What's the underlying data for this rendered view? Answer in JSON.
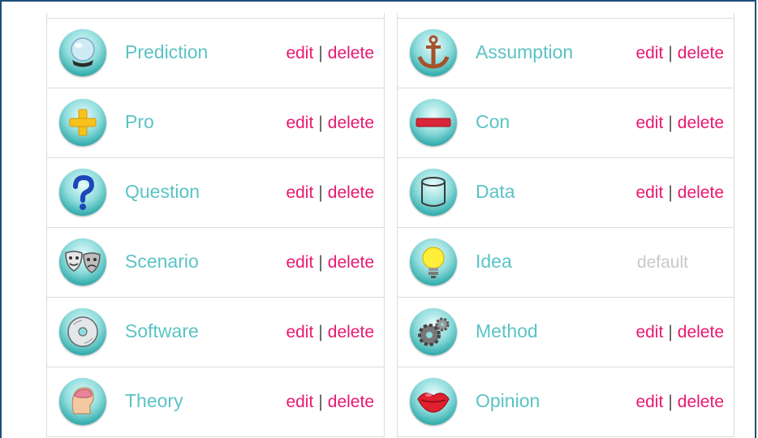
{
  "left_column": [
    {
      "label": "Prediction",
      "icon": "crystal-ball-icon",
      "edit": "edit",
      "sep": "|",
      "delete": "delete"
    },
    {
      "label": "Pro",
      "icon": "plus-icon",
      "edit": "edit",
      "sep": "|",
      "delete": "delete"
    },
    {
      "label": "Question",
      "icon": "question-mark-icon",
      "edit": "edit",
      "sep": "|",
      "delete": "delete"
    },
    {
      "label": "Scenario",
      "icon": "theater-masks-icon",
      "edit": "edit",
      "sep": "|",
      "delete": "delete"
    },
    {
      "label": "Software",
      "icon": "disc-icon",
      "edit": "edit",
      "sep": "|",
      "delete": "delete"
    },
    {
      "label": "Theory",
      "icon": "head-brain-icon",
      "edit": "edit",
      "sep": "|",
      "delete": "delete"
    }
  ],
  "right_column": [
    {
      "label": "Assumption",
      "icon": "anchor-icon",
      "edit": "edit",
      "sep": "|",
      "delete": "delete"
    },
    {
      "label": "Con",
      "icon": "minus-icon",
      "edit": "edit",
      "sep": "|",
      "delete": "delete"
    },
    {
      "label": "Data",
      "icon": "database-cylinder-icon",
      "edit": "edit",
      "sep": "|",
      "delete": "delete"
    },
    {
      "label": "Idea",
      "icon": "lightbulb-icon",
      "status": "default"
    },
    {
      "label": "Method",
      "icon": "gears-icon",
      "edit": "edit",
      "sep": "|",
      "delete": "delete"
    },
    {
      "label": "Opinion",
      "icon": "lips-icon",
      "edit": "edit",
      "sep": "|",
      "delete": "delete"
    }
  ],
  "colors": {
    "label": "#5bc3c5",
    "action_link": "#e8196f",
    "default_text": "#c9c9c9",
    "frame": "#1d4f7a"
  }
}
